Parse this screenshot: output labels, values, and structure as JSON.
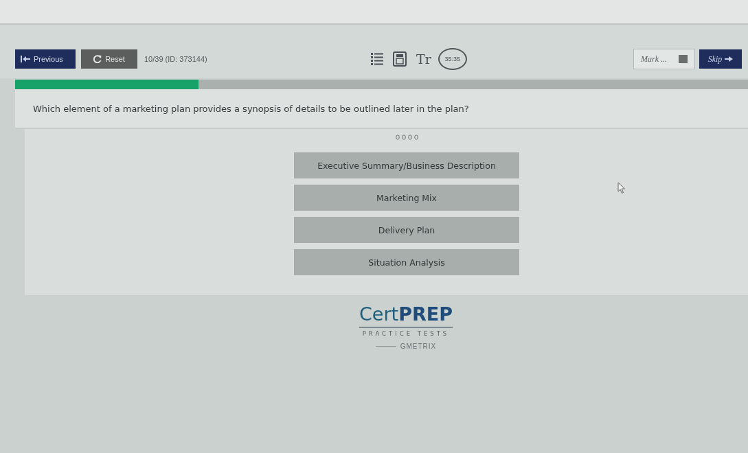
{
  "toolbar": {
    "buttons": [
      {
        "label": "Previous",
        "kind": "previous"
      },
      {
        "label": "Reset",
        "kind": "reset"
      }
    ],
    "question_counter": "10/39 (ID: 373144)",
    "tools": [
      {
        "kind": "list"
      },
      {
        "kind": "calculator"
      },
      {
        "kind": "text-size",
        "glyph": "Tr"
      }
    ],
    "timer": "35:35",
    "mark": {
      "label": "Mark ...",
      "checked": false
    },
    "skip_button": {
      "label": "Skip"
    }
  },
  "progress": {
    "level": 0.25
  },
  "question": {
    "text": "Which element of a marketing plan provides a synopsis of details to be outlined later in the plan?"
  },
  "answers": [
    {
      "text": "Executive Summary/Business Description",
      "selected": false
    },
    {
      "text": "Marketing Mix",
      "selected": false
    },
    {
      "text": "Delivery Plan",
      "selected": false
    },
    {
      "text": "Situation Analysis",
      "selected": false
    }
  ],
  "logo": {
    "brand_light": "Cert",
    "brand_bold": "PREP",
    "tagline": "PRACTICE TESTS",
    "powered_by": "GMETRIX"
  }
}
